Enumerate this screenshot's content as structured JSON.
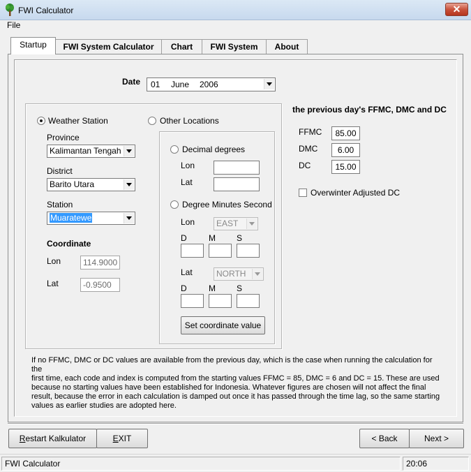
{
  "window": {
    "title": "FWI Calculator"
  },
  "menu": {
    "file": "File"
  },
  "tabs": [
    "Startup",
    "FWI System Calculator",
    "Chart",
    "FWI System",
    "About"
  ],
  "date": {
    "label": "Date",
    "day": "01",
    "month": "June",
    "year": "2006"
  },
  "location": {
    "weather_station_label": "Weather Station",
    "other_locations_label": "Other Locations",
    "province_label": "Province",
    "province_value": "Kalimantan Tengah",
    "district_label": "District",
    "district_value": "Barito Utara",
    "station_label": "Station",
    "station_value": "Muaratewe",
    "coordinate_heading": "Coordinate",
    "lon_label": "Lon",
    "lon_value": "114.9000",
    "lat_label": "Lat",
    "lat_value": "-0.9500"
  },
  "other": {
    "decimal_degrees_label": "Decimal degrees",
    "lon_label": "Lon",
    "lat_label": "Lat",
    "dms_label": "Degree Minutes Second",
    "dms_lon_label": "Lon",
    "dms_lon_dir": "EAST",
    "dms_lat_label": "Lat",
    "dms_lat_dir": "NORTH",
    "d_label": "D",
    "m_label": "M",
    "s_label": "S",
    "set_button": "Set coordinate value"
  },
  "previous": {
    "heading": "the previous day's FFMC, DMC and DC",
    "ffmc_label": "FFMC",
    "ffmc_value": "85.00",
    "dmc_label": "DMC",
    "dmc_value": "6.00",
    "dc_label": "DC",
    "dc_value": "15.00",
    "overwinter_label": "Overwinter Adjusted DC"
  },
  "note": "If no FFMC, DMC or DC values are available from the previous day, which is the case when running the calculation for the\nfirst time, each code and index is computed from the starting values FFMC = 85, DMC = 6 and DC = 15. These are used\nbecause no starting values have been established for Indonesia. Whatever figures are chosen will not affect the final\nresult, because the error in each calculation is damped out once it has passed through the time lag, so the same starting\nvalues as earlier studies are adopted here.",
  "buttons": {
    "restart_prefix": "R",
    "restart_rest": "estart Kalkulator",
    "exit_prefix": "E",
    "exit_rest": "XIT",
    "back": "< Back",
    "next": "Next >"
  },
  "status": {
    "left": "FWI Calculator",
    "time": "20:06"
  }
}
